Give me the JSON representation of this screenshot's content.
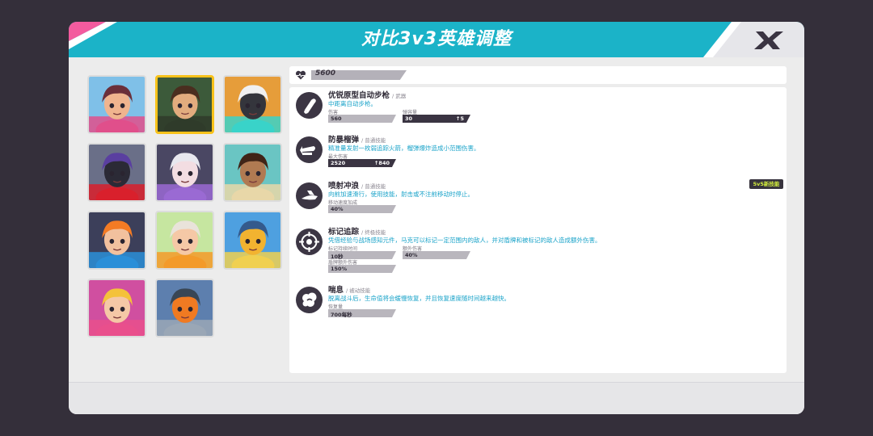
{
  "window": {
    "title": "对比3v3英雄调整",
    "close_label": "X"
  },
  "colors": {
    "title_bar": "#1bb3c8",
    "pink_accent": "#f35b9e",
    "selected_border": "#f8c21a",
    "desc_text": "#1aa3c9",
    "up_text": "#b6e03a",
    "badge_text": "#d4ef3c"
  },
  "heroes": [
    {
      "name": "hero-pink-girl",
      "selected": false
    },
    {
      "name": "hero-brown-hair-boy",
      "selected": true
    },
    {
      "name": "hero-robot-orange",
      "selected": false
    },
    {
      "name": "hero-dark-armor",
      "selected": false
    },
    {
      "name": "hero-white-hair-girl",
      "selected": false
    },
    {
      "name": "hero-dark-girl",
      "selected": false
    },
    {
      "name": "hero-orange-hair-girl",
      "selected": false
    },
    {
      "name": "hero-goggles-girl",
      "selected": false
    },
    {
      "name": "hero-blue-robot",
      "selected": false
    },
    {
      "name": "hero-pink-blonde-girl",
      "selected": false
    },
    {
      "name": "hero-orange-mask",
      "selected": false
    }
  ],
  "stats": {
    "hp": "5600",
    "hp_icon": "heart-pulse-icon"
  },
  "skills": [
    {
      "name": "优锐原型自动步枪",
      "type": "/ 武器",
      "desc": "中距离自动步枪。",
      "icon": "bullet-icon",
      "fields": [
        {
          "label": "伤害",
          "value": "560",
          "dark": false,
          "up": ""
        },
        {
          "label": "弹容量",
          "value": "30",
          "dark": true,
          "up": "↑5"
        }
      ]
    },
    {
      "name": "防暴榴弹",
      "type": "/ 普通技能",
      "desc": "精准量发射一枚弱追踪火箭，榴弹爆炸造成小范围伤害。",
      "icon": "rocket-icon",
      "fields": [
        {
          "label": "最大伤害",
          "value": "2520",
          "dark": true,
          "up": "↑840"
        }
      ]
    },
    {
      "name": "喷射冲浪",
      "type": "/ 普通技能",
      "desc": "向前加速滑行，使用技能，射击或不注前移动时停止。",
      "icon": "surf-icon",
      "badge": "5v5新技能",
      "fields": [
        {
          "label": "移动速度加成",
          "value": "40%",
          "dark": false,
          "up": ""
        }
      ]
    },
    {
      "name": "标记追踪",
      "type": "/ 终极技能",
      "desc": "凭借经验与战场感知元件，马克可以标记一定范围内的敌人，并对盾牌和被标记的敌人造成额外伤害。",
      "icon": "target-icon",
      "fields": [
        {
          "label": "标记持续时间",
          "value": "10秒",
          "dark": false,
          "up": ""
        },
        {
          "label": "额外伤害",
          "value": "40%",
          "dark": false,
          "up": ""
        },
        {
          "label": "盾牌额外伤害",
          "value": "150%",
          "dark": false,
          "up": ""
        }
      ]
    },
    {
      "name": "喘息",
      "type": "/ 被动技能",
      "desc": "脱离战斗后，生命值将会缓慢恢复，并且恢复速度随时间越来越快。",
      "icon": "breath-icon",
      "fields": [
        {
          "label": "恢复量",
          "value": "700每秒",
          "dark": false,
          "up": ""
        }
      ]
    }
  ]
}
